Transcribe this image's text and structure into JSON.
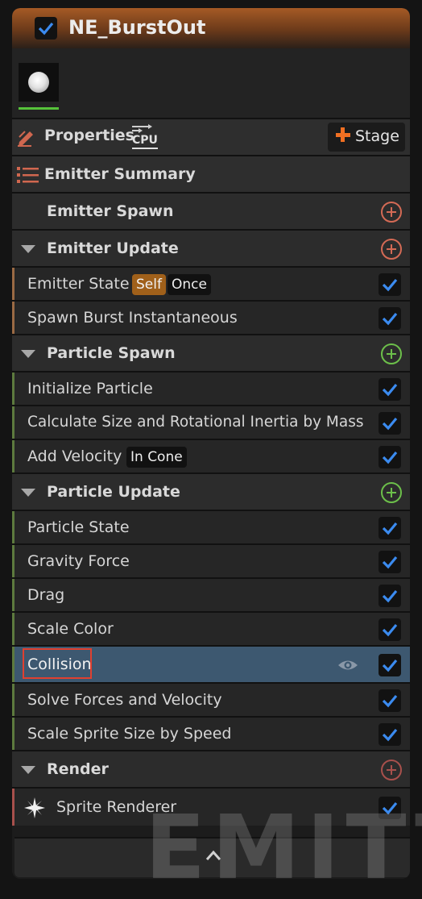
{
  "emitter": {
    "name": "NE_BurstOut",
    "enabled": true
  },
  "toolbar": {
    "properties_label": "Properties",
    "sim_target": "CPU",
    "stage_label": "Stage"
  },
  "summary_label": "Emitter Summary",
  "colors": {
    "accent_check": "#3b8bf0",
    "emitter_stripe": "#9b6a44",
    "spawn_stripe": "#5d7a3e",
    "update_stripe": "#5d7a3e",
    "render_stripe": "#a8504c",
    "add_emitter": "#d46a55",
    "add_particle": "#6cbf4a",
    "selected_row": "#3d5870",
    "tag_self": "#a0601a"
  },
  "sections": {
    "emitter_spawn": {
      "label": "Emitter Spawn"
    },
    "emitter_update": {
      "label": "Emitter Update",
      "items": [
        {
          "label": "Emitter State",
          "tags": [
            "Self",
            "Once"
          ],
          "enabled": true
        },
        {
          "label": "Spawn Burst Instantaneous",
          "enabled": true
        }
      ]
    },
    "particle_spawn": {
      "label": "Particle Spawn",
      "items": [
        {
          "label": "Initialize Particle",
          "enabled": true
        },
        {
          "label": "Calculate Size and Rotational Inertia by Mass",
          "enabled": true
        },
        {
          "label": "Add Velocity",
          "tags": [
            "In Cone"
          ],
          "enabled": true
        }
      ]
    },
    "particle_update": {
      "label": "Particle Update",
      "items": [
        {
          "label": "Particle State",
          "enabled": true
        },
        {
          "label": "Gravity Force",
          "enabled": true
        },
        {
          "label": "Drag",
          "enabled": true
        },
        {
          "label": "Scale Color",
          "enabled": true
        },
        {
          "label": "Collision",
          "enabled": true,
          "selected": true
        },
        {
          "label": "Solve Forces and Velocity",
          "enabled": true
        },
        {
          "label": "Scale Sprite Size by Speed",
          "enabled": true
        }
      ]
    },
    "render": {
      "label": "Render",
      "items": [
        {
          "label": "Sprite Renderer",
          "enabled": true
        }
      ]
    }
  },
  "watermark": "EMITTE"
}
